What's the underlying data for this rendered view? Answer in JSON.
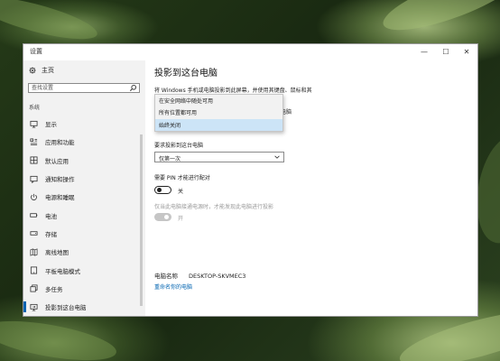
{
  "window": {
    "title": "设置",
    "minimize_glyph": "—",
    "maximize_glyph": "☐",
    "close_glyph": "✕"
  },
  "sidebar": {
    "home": "主页",
    "search_placeholder": "查找设置",
    "section": "系统",
    "items": [
      {
        "label": "显示",
        "icon": "display-icon"
      },
      {
        "label": "应用和功能",
        "icon": "apps-icon"
      },
      {
        "label": "默认应用",
        "icon": "default-apps-icon"
      },
      {
        "label": "通知和操作",
        "icon": "notifications-icon"
      },
      {
        "label": "电源和睡眠",
        "icon": "power-icon"
      },
      {
        "label": "电池",
        "icon": "battery-icon"
      },
      {
        "label": "存储",
        "icon": "storage-icon"
      },
      {
        "label": "离线地图",
        "icon": "map-icon"
      },
      {
        "label": "平板电脑模式",
        "icon": "tablet-icon"
      },
      {
        "label": "多任务",
        "icon": "multitask-icon"
      },
      {
        "label": "投影到这台电脑",
        "icon": "project-icon",
        "active": true
      }
    ]
  },
  "main": {
    "title": "投影到这台电脑",
    "description": "将 Windows 手机或电脑投影到此屏幕，并使用其键盘、鼠标和其",
    "description_tail": "电脑",
    "dropdown_options": [
      "在安全网络中随处可用",
      "所有位置都可用",
      "始终关闭"
    ],
    "dropdown_selected_index": 2,
    "ask_label": "要求投影到这台电脑",
    "ask_value": "仅第一次",
    "pin_label": "需要 PIN 才能进行配对",
    "pin_state": "关",
    "power_label": "仅当此电脑接通电源时，才能发现此电脑进行投影",
    "power_state": "开",
    "pc_name_label": "电脑名称",
    "pc_name_value": "DESKTOP-SKVMEC3",
    "rename_link": "重命名你的电脑"
  },
  "colors": {
    "accent": "#0063b1",
    "selected_option_bg": "#cce4f7"
  }
}
